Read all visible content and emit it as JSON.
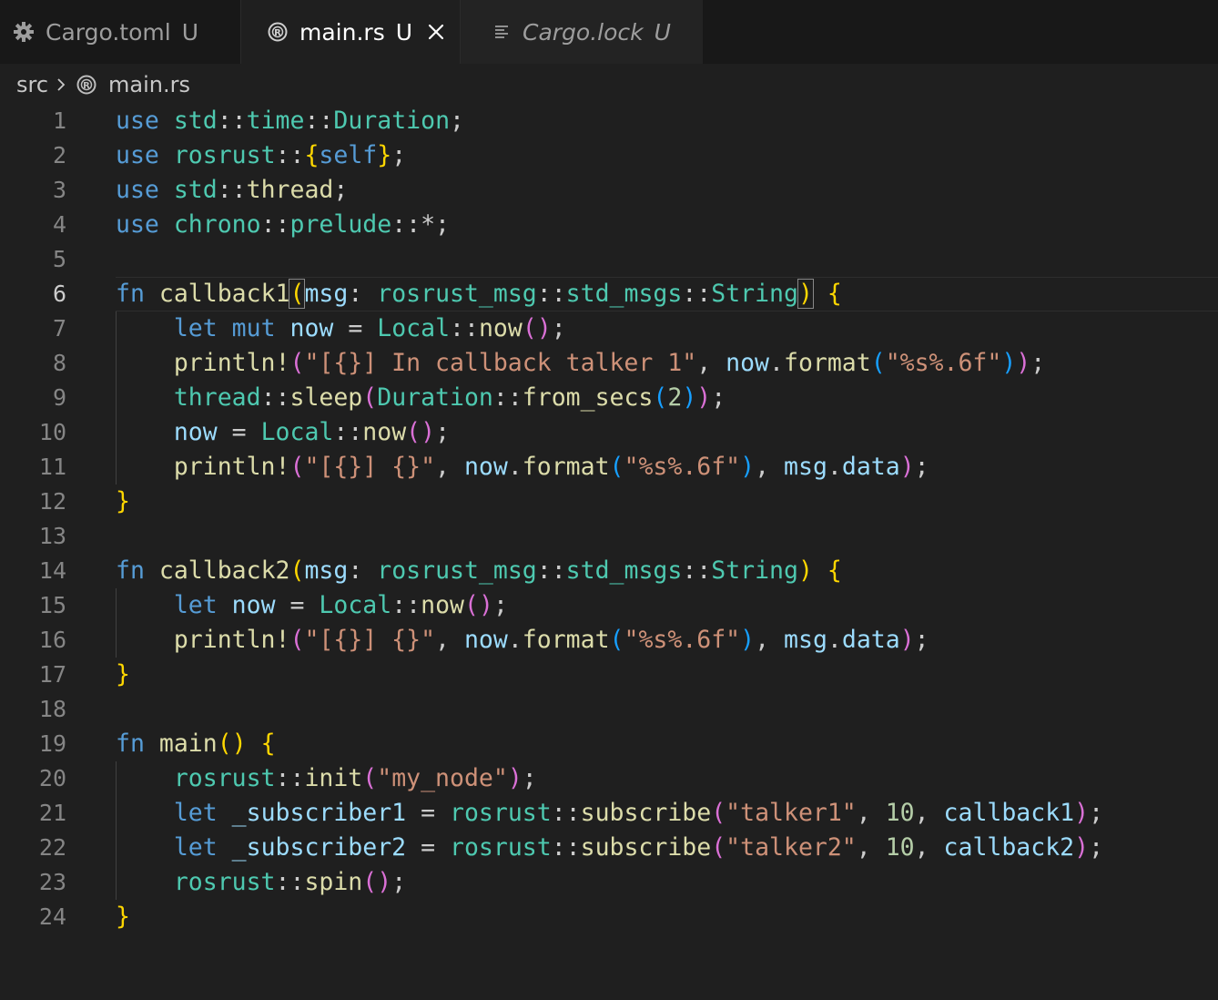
{
  "tabs": [
    {
      "label": "Cargo.toml",
      "status": "U",
      "icon": "gear-icon"
    },
    {
      "label": "main.rs",
      "status": "U",
      "icon": "rust-icon",
      "active": true
    },
    {
      "label": "Cargo.lock",
      "status": "U",
      "icon": "lines-icon"
    }
  ],
  "breadcrumb": {
    "folder": "src",
    "file": "main.rs"
  },
  "line_numbers": [
    "1",
    "2",
    "3",
    "4",
    "5",
    "6",
    "7",
    "8",
    "9",
    "10",
    "11",
    "12",
    "13",
    "14",
    "15",
    "16",
    "17",
    "18",
    "19",
    "20",
    "21",
    "22",
    "23",
    "24"
  ],
  "code": {
    "l1": [
      "use",
      " ",
      "std",
      "::",
      "time",
      "::",
      "Duration",
      ";"
    ],
    "l2": [
      "use",
      " ",
      "rosrust",
      "::",
      "{",
      "self",
      "}",
      ";"
    ],
    "l3": [
      "use",
      " ",
      "std",
      "::",
      "thread",
      ";"
    ],
    "l4": [
      "use",
      " ",
      "chrono",
      "::",
      "prelude",
      "::*;"
    ],
    "l6": [
      "fn",
      " ",
      "callback1",
      "(",
      "msg",
      ": ",
      "rosrust_msg",
      "::",
      "std_msgs",
      "::",
      "String",
      ")",
      " ",
      "{"
    ],
    "l7": [
      "    ",
      "let",
      " ",
      "mut",
      " ",
      "now",
      " = ",
      "Local",
      "::",
      "now",
      "(",
      ")",
      ";"
    ],
    "l8": [
      "    ",
      "println!",
      "(",
      "\"[{}] In callback talker 1\"",
      ", ",
      "now",
      ".",
      "format",
      "(",
      "\"%s%.6f\"",
      ")",
      ")",
      ";"
    ],
    "l9": [
      "    ",
      "thread",
      "::",
      "sleep",
      "(",
      "Duration",
      "::",
      "from_secs",
      "(",
      "2",
      ")",
      ")",
      ";"
    ],
    "l10": [
      "    ",
      "now",
      " = ",
      "Local",
      "::",
      "now",
      "(",
      ")",
      ";"
    ],
    "l11": [
      "    ",
      "println!",
      "(",
      "\"[{}] {}\"",
      ", ",
      "now",
      ".",
      "format",
      "(",
      "\"%s%.6f\"",
      ")",
      ", ",
      "msg",
      ".",
      "data",
      ")",
      ";"
    ],
    "l12": [
      "}"
    ],
    "l14": [
      "fn",
      " ",
      "callback2",
      "(",
      "msg",
      ": ",
      "rosrust_msg",
      "::",
      "std_msgs",
      "::",
      "String",
      ")",
      " ",
      "{"
    ],
    "l15": [
      "    ",
      "let",
      " ",
      "now",
      " = ",
      "Local",
      "::",
      "now",
      "(",
      ")",
      ";"
    ],
    "l16": [
      "    ",
      "println!",
      "(",
      "\"[{}] {}\"",
      ", ",
      "now",
      ".",
      "format",
      "(",
      "\"%s%.6f\"",
      ")",
      ", ",
      "msg",
      ".",
      "data",
      ")",
      ";"
    ],
    "l17": [
      "}"
    ],
    "l19": [
      "fn",
      " ",
      "main",
      "(",
      ")",
      " ",
      "{"
    ],
    "l20": [
      "    ",
      "rosrust",
      "::",
      "init",
      "(",
      "\"my_node\"",
      ")",
      ";"
    ],
    "l21": [
      "    ",
      "let",
      " ",
      "_subscriber1",
      " = ",
      "rosrust",
      "::",
      "subscribe",
      "(",
      "\"talker1\"",
      ", ",
      "10",
      ", ",
      "callback1",
      ")",
      ";"
    ],
    "l22": [
      "    ",
      "let",
      " ",
      "_subscriber2",
      " = ",
      "rosrust",
      "::",
      "subscribe",
      "(",
      "\"talker2\"",
      ", ",
      "10",
      ", ",
      "callback2",
      ")",
      ";"
    ],
    "l23": [
      "    ",
      "rosrust",
      "::",
      "spin",
      "(",
      ")",
      ";"
    ],
    "l24": [
      "}"
    ]
  },
  "colors": {
    "background": "#1f1f1f",
    "keyword": "#569cd6",
    "type": "#4ec9b0",
    "function": "#dcdcaa",
    "variable": "#9cdcfe",
    "string": "#ce9178",
    "number": "#b5cea8",
    "bracket_level_1": "#ffd700",
    "bracket_level_2": "#da70d6",
    "bracket_level_3": "#179fff"
  }
}
